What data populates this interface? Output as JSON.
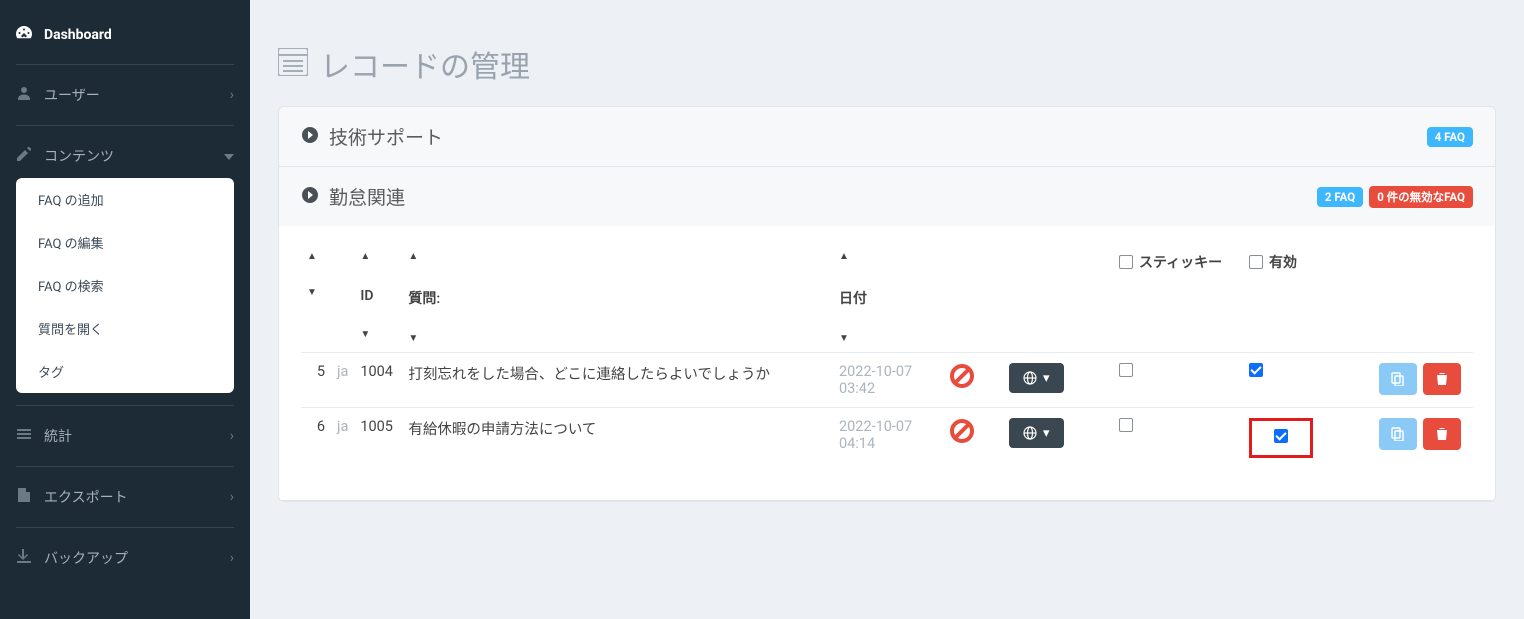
{
  "sidebar": {
    "dashboard": "Dashboard",
    "user": "ユーザー",
    "contents": "コンテンツ",
    "contents_sub": {
      "add": "FAQ の追加",
      "edit": "FAQ の編集",
      "search": "FAQ の検索",
      "open": "質問を開く",
      "tag": "タグ"
    },
    "stats": "統計",
    "export": "エクスポート",
    "backup": "バックアップ"
  },
  "page_title": "レコードの管理",
  "sections": {
    "tech": {
      "title": "技術サポート",
      "faq_count": "4 FAQ"
    },
    "att": {
      "title": "勤怠関連",
      "faq_count": "2 FAQ",
      "invalid": "0 件の無効なFAQ"
    }
  },
  "table": {
    "headers": {
      "id": "ID",
      "question": "質問:",
      "date": "日付",
      "sticky": "スティッキー",
      "active": "有効"
    },
    "rows": [
      {
        "seq": "5",
        "lang": "ja",
        "id": "1004",
        "question": "打刻忘れをした場合、どこに連絡したらよいでしょうか",
        "date": "2022-10-07 03:42",
        "sticky": false,
        "active": true,
        "highlight": false
      },
      {
        "seq": "6",
        "lang": "ja",
        "id": "1005",
        "question": "有給休暇の申請方法について",
        "date": "2022-10-07 04:14",
        "sticky": false,
        "active": true,
        "highlight": true
      }
    ]
  }
}
